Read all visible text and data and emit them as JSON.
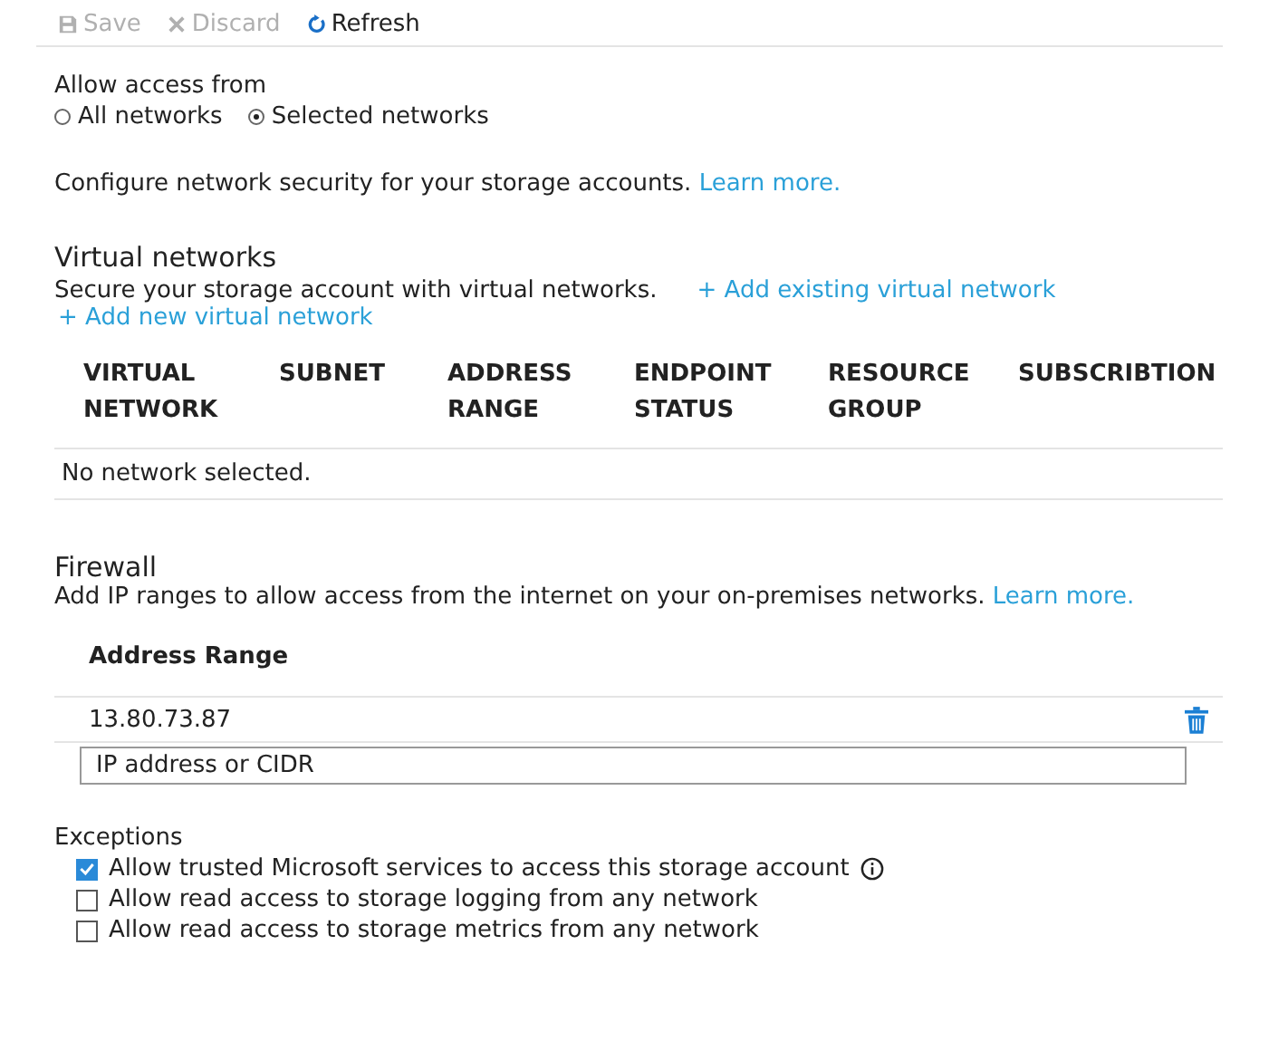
{
  "toolbar": [
    {
      "kind": "save",
      "label": "Save",
      "disabled": true
    },
    {
      "kind": "discard",
      "label": "Discard",
      "disabled": true
    },
    {
      "kind": "refresh",
      "label": "Refresh",
      "disabled": false
    }
  ],
  "access": {
    "label": "Allow access from",
    "options": [
      {
        "label": "All networks",
        "selected": false
      },
      {
        "label": "Selected networks",
        "selected": true
      }
    ]
  },
  "intro": {
    "text": "Configure network security for your storage accounts.",
    "link": "Learn more."
  },
  "virtual_networks": {
    "title": "Virtual networks",
    "description": "Secure your storage account with virtual networks.",
    "add_existing": "+ Add existing virtual network",
    "add_new": "+ Add new virtual network",
    "columns": [
      "VIRTUAL NETWORK",
      "SUBNET",
      "ADDRESS RANGE",
      "ENDPOINT STATUS",
      "RESOURCE GROUP",
      "SUBSCRIBTION"
    ],
    "empty": "No network selected."
  },
  "firewall": {
    "title": "Firewall",
    "description": "Add IP ranges to allow access from the internet on your on-premises networks.",
    "link": "Learn more.",
    "column": "Address Range",
    "rows": [
      {
        "address": "13.80.73.87"
      }
    ],
    "input": {
      "placeholder": "IP address or CIDR"
    }
  },
  "exceptions": {
    "title": "Exceptions",
    "items": [
      {
        "label": "Allow trusted Microsoft services to access this storage account",
        "checked": true,
        "info": true
      },
      {
        "label": "Allow read access to storage logging from any network",
        "checked": false,
        "info": false
      },
      {
        "label": "Allow read access to storage metrics from any network",
        "checked": false,
        "info": false
      }
    ]
  }
}
